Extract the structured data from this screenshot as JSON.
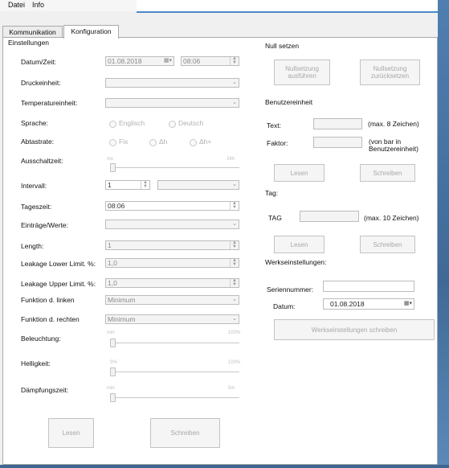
{
  "menu": {
    "datei": "Datei",
    "info": "Info"
  },
  "tabs": {
    "kommunikation": "Kommunikation",
    "konfiguration": "Konfiguration"
  },
  "left": {
    "group_title": "Einstellungen",
    "datum_zeit": {
      "label": "Datum/Zeit:",
      "date": "01.08.2018",
      "time": "08:06"
    },
    "druckeinheit": {
      "label": "Druckeinheit:"
    },
    "temperatureinheit": {
      "label": "Temperatureinheit:"
    },
    "sprache": {
      "label": "Sprache:",
      "options": [
        "Englisch",
        "Deutsch"
      ]
    },
    "abtastrate": {
      "label": "Abtastrate:",
      "options": [
        "Fix",
        "Δh",
        "Δh+"
      ]
    },
    "ausschaltzeit": {
      "label": "Ausschaltzeit:",
      "min": "ms",
      "max": "24h"
    },
    "intervall": {
      "label": "Intervall:",
      "value": "1"
    },
    "tageszeit": {
      "label": "Tageszeit:",
      "value": "08:06"
    },
    "eintraege": {
      "label": "Einträge/Werte:"
    },
    "length": {
      "label": "Length:",
      "value": "1"
    },
    "leak_lower": {
      "label": "Leakage Lower Limit. %:",
      "value": "1,0"
    },
    "leak_upper": {
      "label": "Leakage Upper Limit. %:",
      "value": "1,0"
    },
    "funktion_links": {
      "label": "Funktion d. linken",
      "value": "Minimum"
    },
    "funktion_rechts": {
      "label": "Funktion d. rechten",
      "value": "Minimum"
    },
    "beleuchtung": {
      "label": "Beleuchtung:",
      "min": "min",
      "max": "100%"
    },
    "helligkeit": {
      "label": "Helligkeit:",
      "min": "0%",
      "max": "100%"
    },
    "daempfung": {
      "label": "Dämpfungszeit:",
      "min": "min",
      "max": "5m"
    },
    "lesen": "Lesen",
    "schreiben": "Schreiben"
  },
  "right": {
    "null_setzen": "Null setzen",
    "nullen_ausfuehren": "Nullsetzung ausführen",
    "nullen_zuruecksetzen": "Nullsetzung zurücksetzen",
    "benutzereinheit": "Benutzereinheit",
    "text_label": "Text:",
    "text_hint": "(max. 8 Zeichen)",
    "faktor_label": "Faktor:",
    "faktor_hint": "(von bar in Benutzereinheit)",
    "lesen": "Lesen",
    "schreiben": "Schreiben",
    "tag_title": "Tag:",
    "tag_label": "TAG",
    "tag_hint": "(max. 10 Zeichen)",
    "werkseinstellungen": "Werkseinstellungen:",
    "seriennummer": "Seriennummer:",
    "datum_label": "Datum:",
    "datum_value": "01.08.2018",
    "werk_button": "Werkseinstellungen schreiben"
  }
}
